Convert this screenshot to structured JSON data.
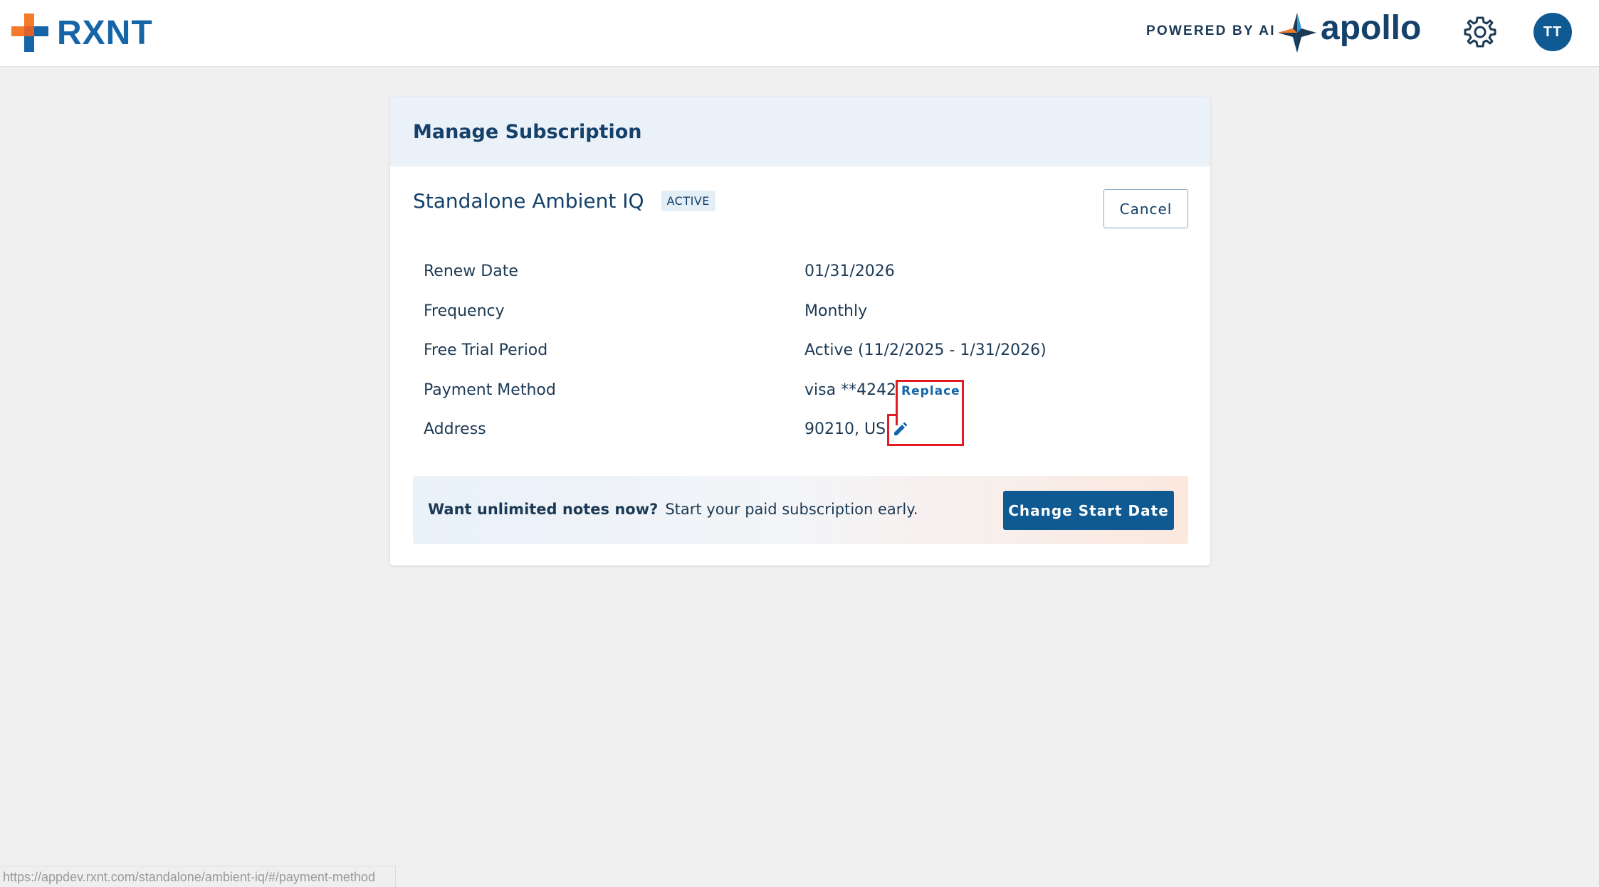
{
  "brand": {
    "name": "RXNT",
    "accent": "#1466a8",
    "orange": "#f47b2a"
  },
  "header": {
    "powered_by": "POWERED BY AI",
    "partner": "apollo",
    "settings_icon": "gear-icon",
    "avatar_initials": "TT"
  },
  "card": {
    "title": "Manage Subscription",
    "subscription": {
      "name": "Standalone Ambient IQ",
      "status": "ACTIVE",
      "cancel_label": "Cancel"
    },
    "details": [
      {
        "label": "Renew Date",
        "value": "01/31/2026"
      },
      {
        "label": "Frequency",
        "value": "Monthly"
      },
      {
        "label": "Free Trial Period",
        "value": "Active (11/2/2025 - 1/31/2026)"
      },
      {
        "label": "Payment Method",
        "value": "visa **4242"
      },
      {
        "label": "Address",
        "value": "90210, US"
      }
    ],
    "replace_label": "Replace",
    "edit_icon": "pencil-icon",
    "promo": {
      "headline": "Want unlimited notes now?",
      "text": "Start your paid subscription early.",
      "button_label": "Change Start Date"
    }
  },
  "status_url": "https://appdev.rxnt.com/standalone/ambient-iq/#/payment-method"
}
